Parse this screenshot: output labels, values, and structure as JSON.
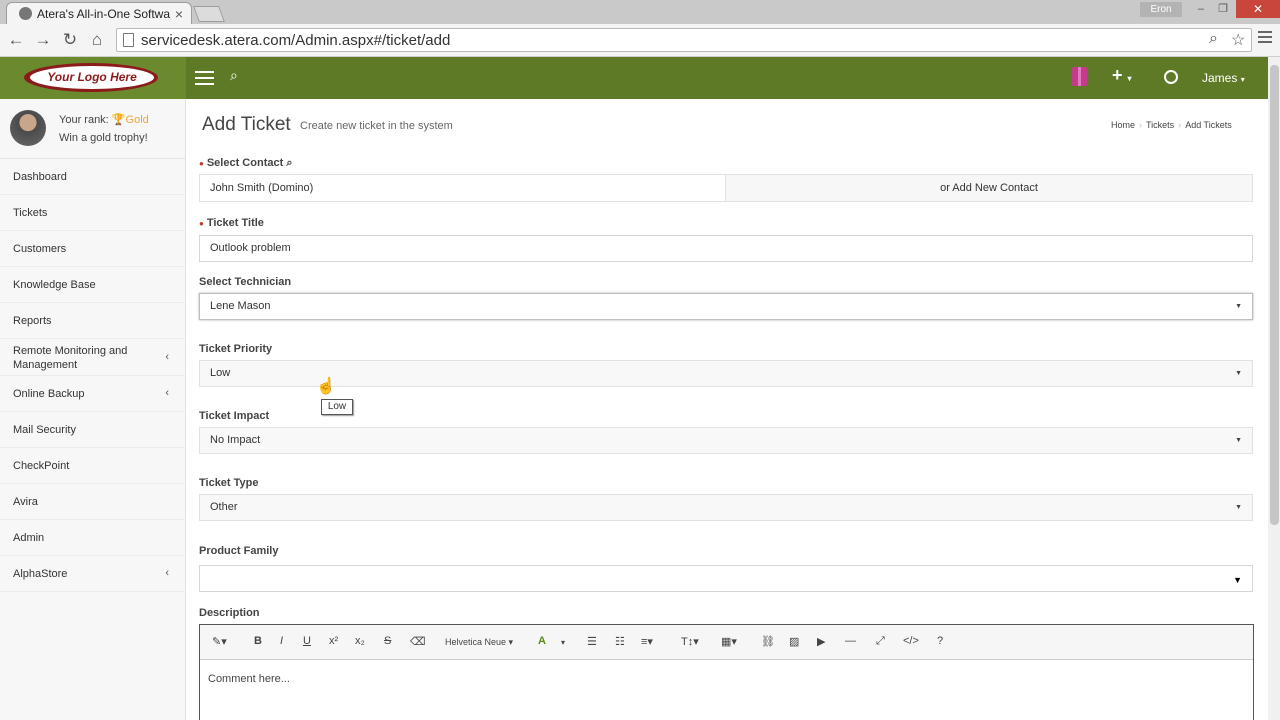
{
  "browser": {
    "tab_title": "Atera's All-in-One Softwa",
    "tab_close": "×",
    "window_user": "Eron",
    "url": "servicedesk.atera.com/Admin.aspx#/ticket/add"
  },
  "header": {
    "logo_text": "Your Logo Here",
    "user_name": "James",
    "accent": "#5f7a27"
  },
  "sidebar": {
    "rank_label": "Your rank:",
    "rank_value": "Gold",
    "trophy_text": "Win a gold trophy!",
    "items": [
      {
        "label": "Dashboard"
      },
      {
        "label": "Tickets"
      },
      {
        "label": "Customers"
      },
      {
        "label": "Knowledge Base"
      },
      {
        "label": "Reports"
      },
      {
        "label": "Remote Monitoring and Management"
      },
      {
        "label": "Online Backup"
      },
      {
        "label": "Mail Security"
      },
      {
        "label": "CheckPoint"
      },
      {
        "label": "Avira"
      },
      {
        "label": "Admin"
      },
      {
        "label": "AlphaStore"
      }
    ]
  },
  "page": {
    "title": "Add Ticket",
    "subtitle": "Create new ticket in the system",
    "breadcrumbs": [
      "Home",
      "Tickets",
      "Add Tickets"
    ]
  },
  "form": {
    "contact_label": "Select Contact",
    "contact_value": "John Smith (Domino)",
    "add_contact_label": "or Add New Contact",
    "title_label": "Ticket Title",
    "title_value": "Outlook problem",
    "technician_label": "Select Technician",
    "technician_value": "Lene Mason",
    "priority_label": "Ticket Priority",
    "priority_value": "Low",
    "impact_label": "Ticket Impact",
    "impact_value": "No Impact",
    "type_label": "Ticket Type",
    "type_value": "Other",
    "product_label": "Product Family",
    "product_value": "",
    "description_label": "Description",
    "editor_font": "Helvetica Neue",
    "editor_placeholder": "Comment here...",
    "tooltip": "Low"
  }
}
